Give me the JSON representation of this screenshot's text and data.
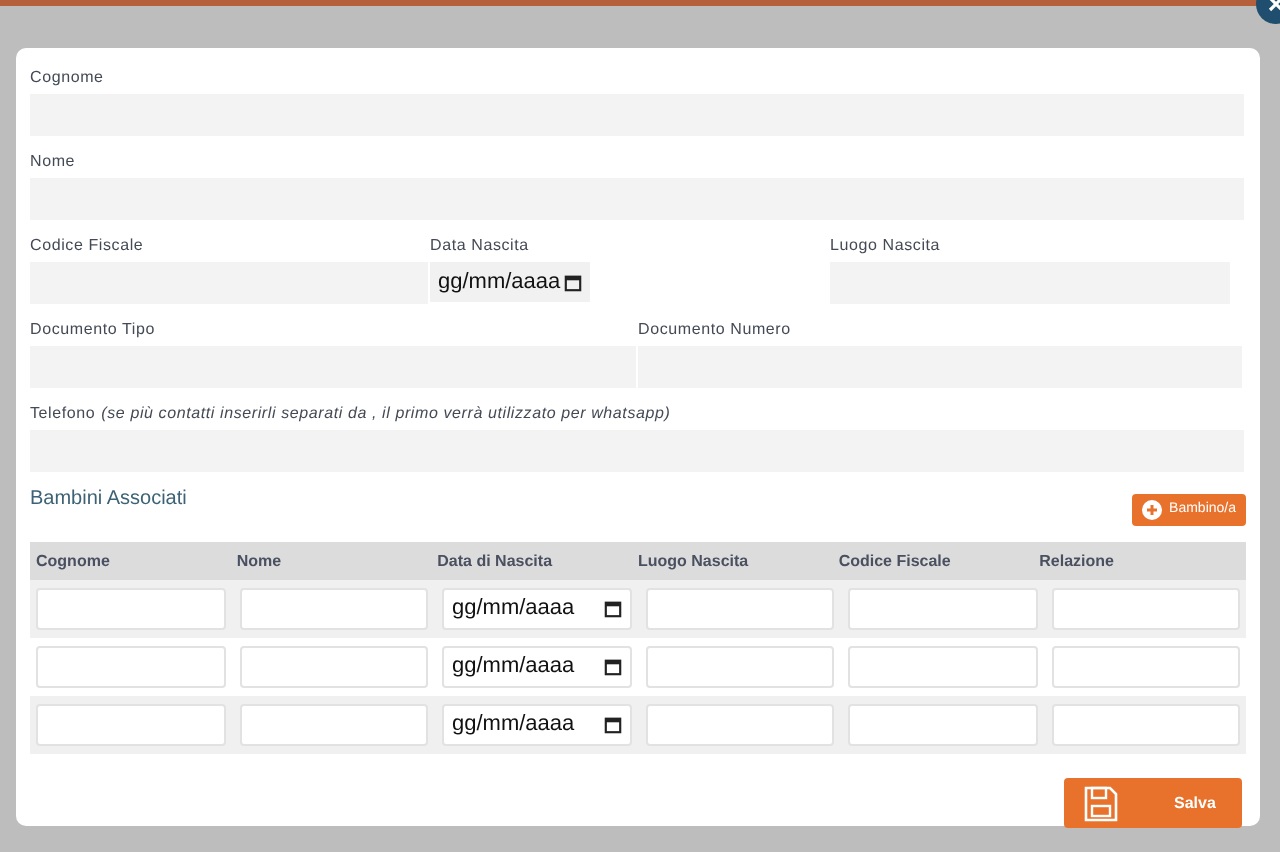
{
  "form_rows": [
    [
      {
        "label": "Cognome",
        "kind": "text"
      }
    ],
    [
      {
        "label": "Nome",
        "kind": "text"
      }
    ],
    [
      {
        "label": "Codice Fiscale",
        "kind": "text"
      },
      {
        "label": "Data Nascita",
        "kind": "date",
        "placeholder": "gg/mm/aaaa"
      },
      {
        "label": "Luogo Nascita",
        "kind": "text"
      }
    ],
    [
      {
        "label": "Documento Tipo",
        "kind": "text"
      },
      {
        "label": "Documento Numero",
        "kind": "text"
      }
    ],
    [
      {
        "label": "Telefono",
        "hint": "(se più contatti inserirli separati da , il primo verrà utilizzato per whatsapp)",
        "kind": "text"
      }
    ]
  ],
  "children_section": {
    "title": "Bambini Associati",
    "add_button": "Bambino/a",
    "columns": [
      "Cognome",
      "Nome",
      "Data di Nascita",
      "Luogo Nascita",
      "Codice Fiscale",
      "Relazione"
    ],
    "rows": [
      [
        {
          "kind": "text"
        },
        {
          "kind": "text"
        },
        {
          "kind": "date",
          "placeholder": "gg/mm/aaaa"
        },
        {
          "kind": "text"
        },
        {
          "kind": "text"
        },
        {
          "kind": "text"
        }
      ],
      [
        {
          "kind": "text"
        },
        {
          "kind": "text"
        },
        {
          "kind": "date",
          "placeholder": "gg/mm/aaaa"
        },
        {
          "kind": "text"
        },
        {
          "kind": "text"
        },
        {
          "kind": "text"
        }
      ],
      [
        {
          "kind": "text"
        },
        {
          "kind": "text"
        },
        {
          "kind": "date",
          "placeholder": "gg/mm/aaaa"
        },
        {
          "kind": "text"
        },
        {
          "kind": "text"
        },
        {
          "kind": "text"
        }
      ]
    ]
  },
  "save_button": "Salva"
}
